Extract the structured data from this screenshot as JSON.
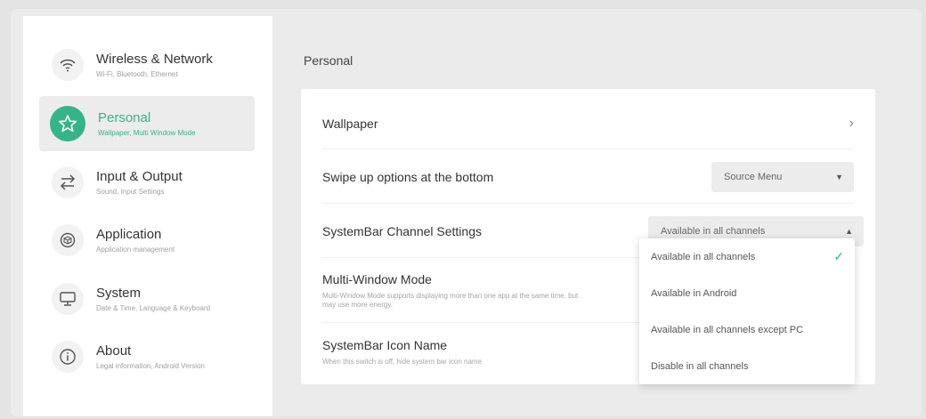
{
  "sidebar": {
    "items": [
      {
        "title": "Wireless & Network",
        "subtitle": "Wi-Fi, Bluetooth, Ethernet",
        "icon": "wifi-icon"
      },
      {
        "title": "Personal",
        "subtitle": "Wallpaper, Multi Window Mode",
        "icon": "star-icon"
      },
      {
        "title": "Input & Output",
        "subtitle": "Sound, Input Settings",
        "icon": "swap-arrows-icon"
      },
      {
        "title": "Application",
        "subtitle": "Application management",
        "icon": "cube-icon"
      },
      {
        "title": "System",
        "subtitle": "Date & Time, Language & Keyboard",
        "icon": "monitor-icon"
      },
      {
        "title": "About",
        "subtitle": "Legal information, Android Version",
        "icon": "info-icon"
      }
    ],
    "active_index": 1
  },
  "main": {
    "title": "Personal",
    "rows": {
      "wallpaper": {
        "label": "Wallpaper"
      },
      "swipe": {
        "label": "Swipe up options at the bottom",
        "value": "Source Menu"
      },
      "channel": {
        "label": "SystemBar Channel Settings",
        "value": "Available in all channels"
      },
      "multiwindow": {
        "label": "Multi-Window Mode",
        "desc": "Multi-Window Mode supports displaying more than one app at the same time, but may use more energy."
      },
      "iconname": {
        "label": "SystemBar Icon Name",
        "desc": "When this switch is off, hide system bar icon name"
      }
    }
  },
  "dropdown": {
    "options": [
      "Available in all channels",
      "Available in Android",
      "Available in all channels except PC",
      "Disable in all channels"
    ],
    "selected_index": 0
  },
  "colors": {
    "accent": "#35b48a"
  }
}
